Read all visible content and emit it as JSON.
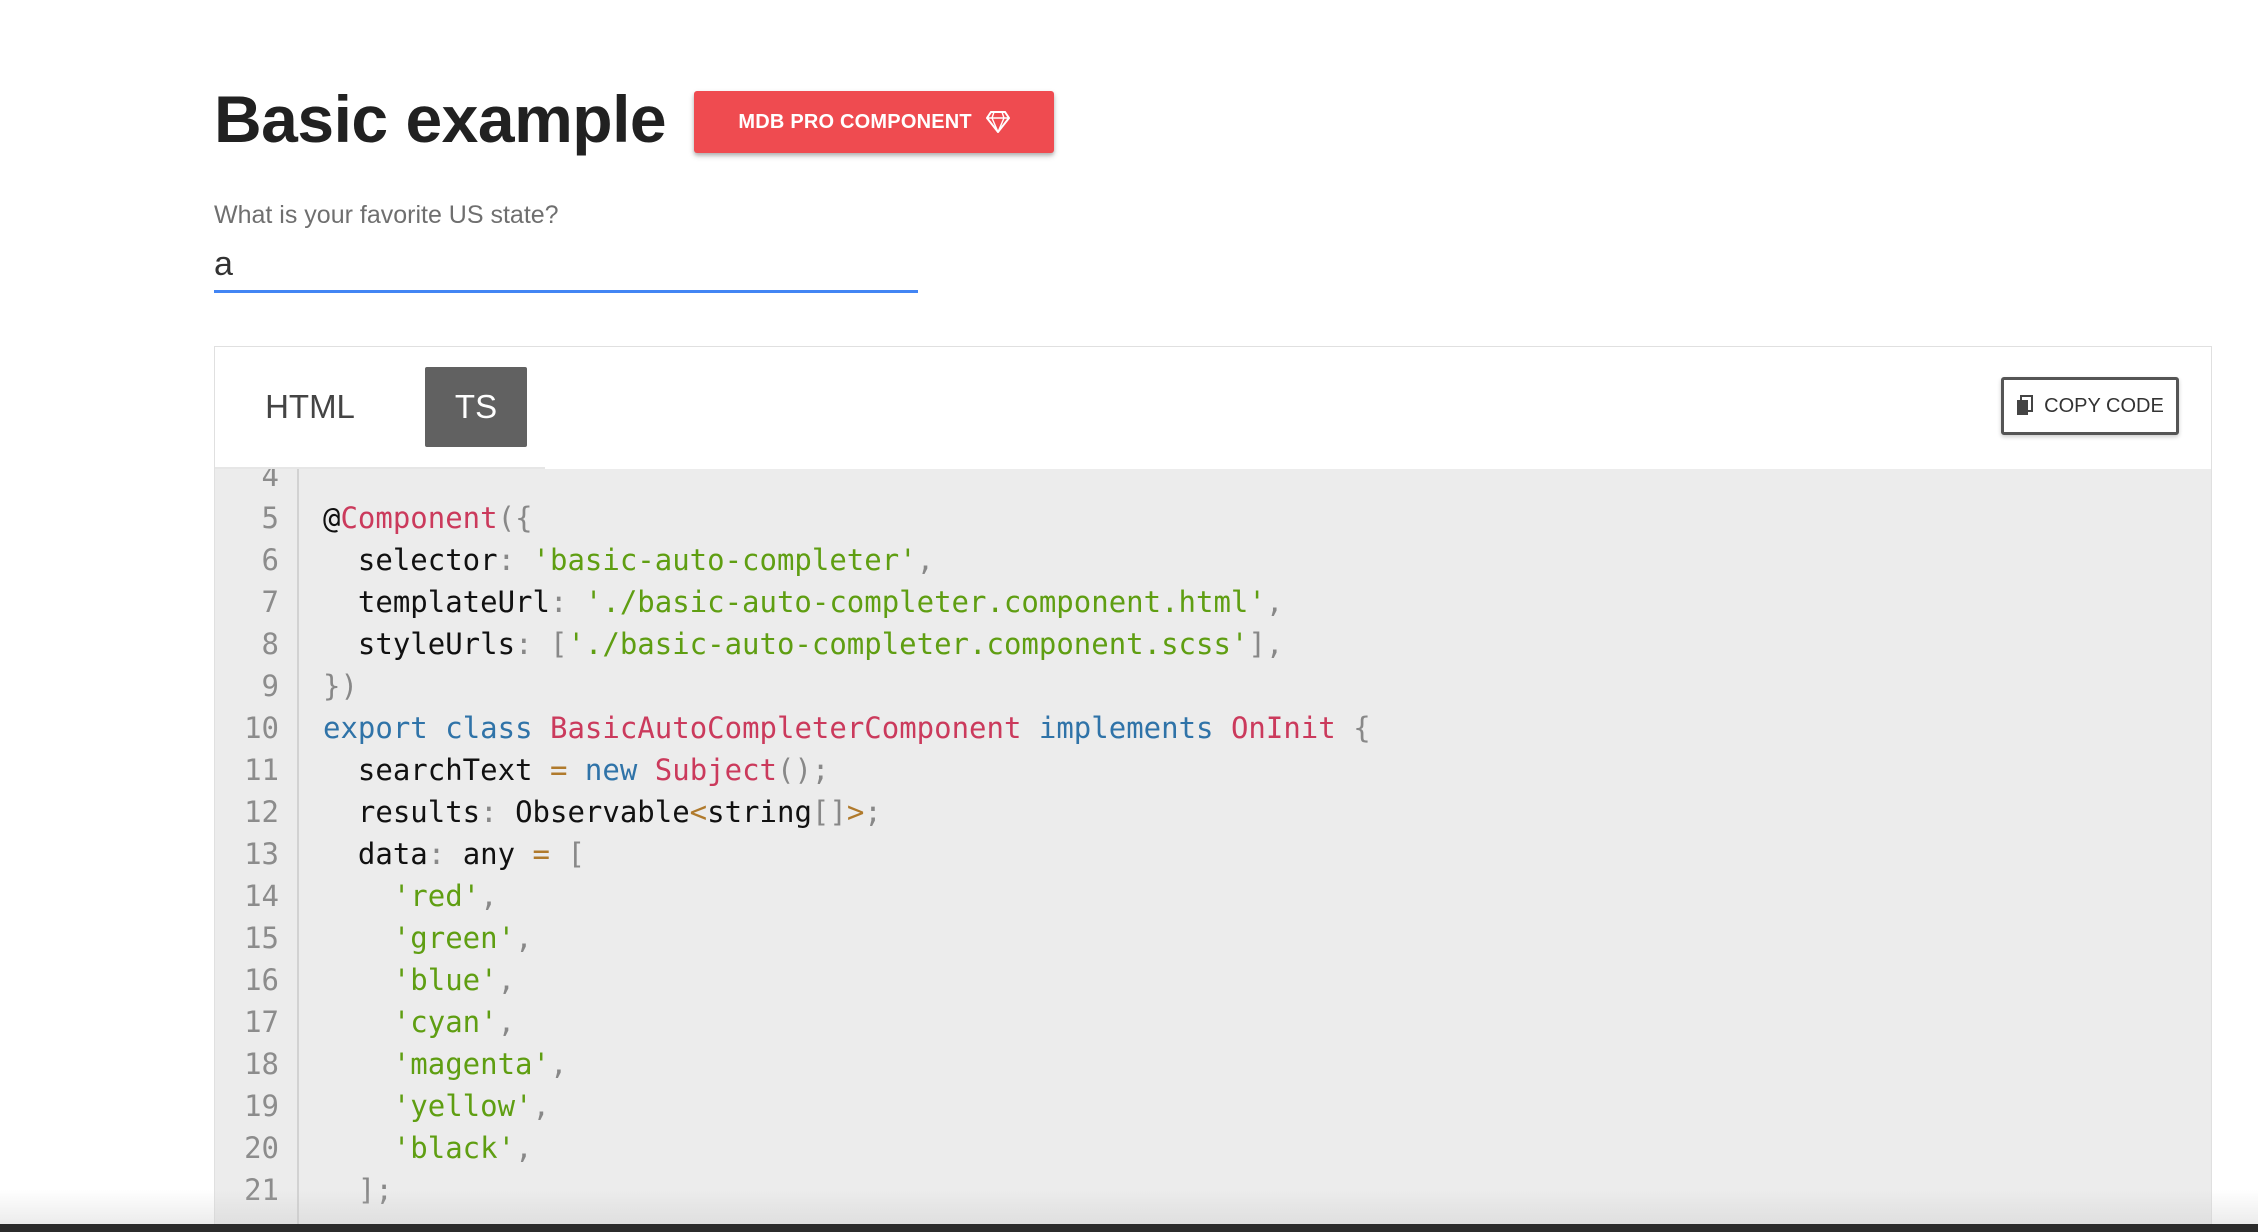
{
  "header": {
    "title": "Basic example",
    "badge_label": "MDB PRO COMPONENT",
    "badge_icon": "gem-icon",
    "badge_color": "#ef4b50"
  },
  "field": {
    "label": "What is your favorite US state?",
    "value": "a",
    "underline_color": "#4285f4"
  },
  "code_panel": {
    "tabs": [
      {
        "label": "HTML",
        "active": false
      },
      {
        "label": "TS",
        "active": true
      }
    ],
    "copy_label": "COPY CODE",
    "copy_icon": "copy-icon",
    "lines": [
      {
        "n": "4",
        "tokens": []
      },
      {
        "n": "5",
        "tokens": [
          [
            "p",
            "@"
          ],
          [
            "c",
            "Component"
          ],
          [
            "u",
            "({"
          ]
        ]
      },
      {
        "n": "6",
        "tokens": [
          [
            "p",
            "  selector"
          ],
          [
            "u",
            ": "
          ],
          [
            "s",
            "'basic-auto-completer'"
          ],
          [
            "u",
            ","
          ]
        ]
      },
      {
        "n": "7",
        "tokens": [
          [
            "p",
            "  templateUrl"
          ],
          [
            "u",
            ": "
          ],
          [
            "s",
            "'./basic-auto-completer.component.html'"
          ],
          [
            "u",
            ","
          ]
        ]
      },
      {
        "n": "8",
        "tokens": [
          [
            "p",
            "  styleUrls"
          ],
          [
            "u",
            ": ["
          ],
          [
            "s",
            "'./basic-auto-completer.component.scss'"
          ],
          [
            "u",
            "],"
          ]
        ]
      },
      {
        "n": "9",
        "tokens": [
          [
            "u",
            "})"
          ]
        ]
      },
      {
        "n": "10",
        "tokens": [
          [
            "k",
            "export"
          ],
          [
            "p",
            " "
          ],
          [
            "k",
            "class"
          ],
          [
            "p",
            " "
          ],
          [
            "c",
            "BasicAutoCompleterComponent"
          ],
          [
            "p",
            " "
          ],
          [
            "k",
            "implements"
          ],
          [
            "p",
            " "
          ],
          [
            "c",
            "OnInit"
          ],
          [
            "p",
            " "
          ],
          [
            "u",
            "{"
          ]
        ]
      },
      {
        "n": "11",
        "tokens": [
          [
            "p",
            "  searchText "
          ],
          [
            "o",
            "="
          ],
          [
            "p",
            " "
          ],
          [
            "k",
            "new"
          ],
          [
            "p",
            " "
          ],
          [
            "c",
            "Subject"
          ],
          [
            "u",
            "();"
          ]
        ]
      },
      {
        "n": "12",
        "tokens": [
          [
            "p",
            "  results"
          ],
          [
            "u",
            ": "
          ],
          [
            "p",
            "Observable"
          ],
          [
            "o",
            "<"
          ],
          [
            "p",
            "string"
          ],
          [
            "u",
            "[]"
          ],
          [
            "o",
            ">"
          ],
          [
            "u",
            ";"
          ]
        ]
      },
      {
        "n": "13",
        "tokens": [
          [
            "p",
            "  data"
          ],
          [
            "u",
            ": "
          ],
          [
            "p",
            "any "
          ],
          [
            "o",
            "="
          ],
          [
            "p",
            " "
          ],
          [
            "u",
            "["
          ]
        ]
      },
      {
        "n": "14",
        "tokens": [
          [
            "p",
            "    "
          ],
          [
            "s",
            "'red'"
          ],
          [
            "u",
            ","
          ]
        ]
      },
      {
        "n": "15",
        "tokens": [
          [
            "p",
            "    "
          ],
          [
            "s",
            "'green'"
          ],
          [
            "u",
            ","
          ]
        ]
      },
      {
        "n": "16",
        "tokens": [
          [
            "p",
            "    "
          ],
          [
            "s",
            "'blue'"
          ],
          [
            "u",
            ","
          ]
        ]
      },
      {
        "n": "17",
        "tokens": [
          [
            "p",
            "    "
          ],
          [
            "s",
            "'cyan'"
          ],
          [
            "u",
            ","
          ]
        ]
      },
      {
        "n": "18",
        "tokens": [
          [
            "p",
            "    "
          ],
          [
            "s",
            "'magenta'"
          ],
          [
            "u",
            ","
          ]
        ]
      },
      {
        "n": "19",
        "tokens": [
          [
            "p",
            "    "
          ],
          [
            "s",
            "'yellow'"
          ],
          [
            "u",
            ","
          ]
        ]
      },
      {
        "n": "20",
        "tokens": [
          [
            "p",
            "    "
          ],
          [
            "s",
            "'black'"
          ],
          [
            "u",
            ","
          ]
        ]
      },
      {
        "n": "21",
        "tokens": [
          [
            "p",
            "  "
          ],
          [
            "u",
            "];"
          ]
        ]
      }
    ]
  }
}
